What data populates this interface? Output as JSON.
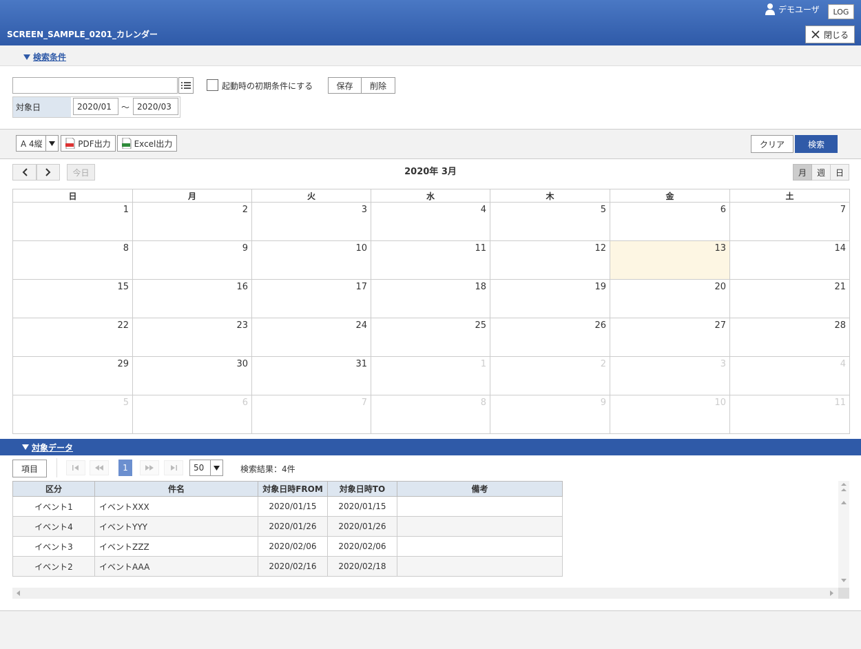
{
  "header": {
    "title": "SCREEN_SAMPLE_0201_カレンダー",
    "user": "デモユーザ",
    "log_label": "LOG",
    "close_label": "閉じる"
  },
  "search": {
    "section_label": "検索条件",
    "condition_value": "",
    "initial_checkbox_label": "起動時の初期条件にする",
    "save_label": "保存",
    "delete_label": "削除",
    "target_date_label": "対象日",
    "date_from": "2020/01",
    "tilde": "～",
    "date_to": "2020/03"
  },
  "toolbar": {
    "paper_size": "A 4縦",
    "pdf_label": "PDF出力",
    "excel_label": "Excel出力",
    "clear_label": "クリア",
    "search_label": "検索"
  },
  "calendar": {
    "today_label": "今日",
    "title": "2020年 3月",
    "views": [
      "月",
      "週",
      "日"
    ],
    "weekdays": [
      "日",
      "月",
      "火",
      "水",
      "木",
      "金",
      "土"
    ],
    "weeks": [
      [
        {
          "d": "1"
        },
        {
          "d": "2"
        },
        {
          "d": "3"
        },
        {
          "d": "4"
        },
        {
          "d": "5"
        },
        {
          "d": "6"
        },
        {
          "d": "7"
        }
      ],
      [
        {
          "d": "8"
        },
        {
          "d": "9"
        },
        {
          "d": "10"
        },
        {
          "d": "11"
        },
        {
          "d": "12"
        },
        {
          "d": "13",
          "today": true
        },
        {
          "d": "14"
        }
      ],
      [
        {
          "d": "15"
        },
        {
          "d": "16"
        },
        {
          "d": "17"
        },
        {
          "d": "18"
        },
        {
          "d": "19"
        },
        {
          "d": "20"
        },
        {
          "d": "21"
        }
      ],
      [
        {
          "d": "22"
        },
        {
          "d": "23"
        },
        {
          "d": "24"
        },
        {
          "d": "25"
        },
        {
          "d": "26"
        },
        {
          "d": "27"
        },
        {
          "d": "28"
        }
      ],
      [
        {
          "d": "29"
        },
        {
          "d": "30"
        },
        {
          "d": "31"
        },
        {
          "d": "1",
          "other": true
        },
        {
          "d": "2",
          "other": true
        },
        {
          "d": "3",
          "other": true
        },
        {
          "d": "4",
          "other": true
        }
      ],
      [
        {
          "d": "5",
          "other": true
        },
        {
          "d": "6",
          "other": true
        },
        {
          "d": "7",
          "other": true
        },
        {
          "d": "8",
          "other": true
        },
        {
          "d": "9",
          "other": true
        },
        {
          "d": "10",
          "other": true
        },
        {
          "d": "11",
          "other": true
        }
      ]
    ]
  },
  "data": {
    "section_label": "対象データ",
    "columns_button": "項目",
    "page": "1",
    "page_size": "50",
    "result_text": "検索結果：4件",
    "headers": [
      "区分",
      "件名",
      "対象日時FROM",
      "対象日時TO",
      "備考"
    ],
    "rows": [
      [
        "イベント1",
        "イベントXXX",
        "2020/01/15",
        "2020/01/15",
        ""
      ],
      [
        "イベント4",
        "イベントYYY",
        "2020/01/26",
        "2020/01/26",
        ""
      ],
      [
        "イベント3",
        "イベントZZZ",
        "2020/02/06",
        "2020/02/06",
        ""
      ],
      [
        "イベント2",
        "イベントAAA",
        "2020/02/16",
        "2020/02/18",
        ""
      ]
    ]
  }
}
